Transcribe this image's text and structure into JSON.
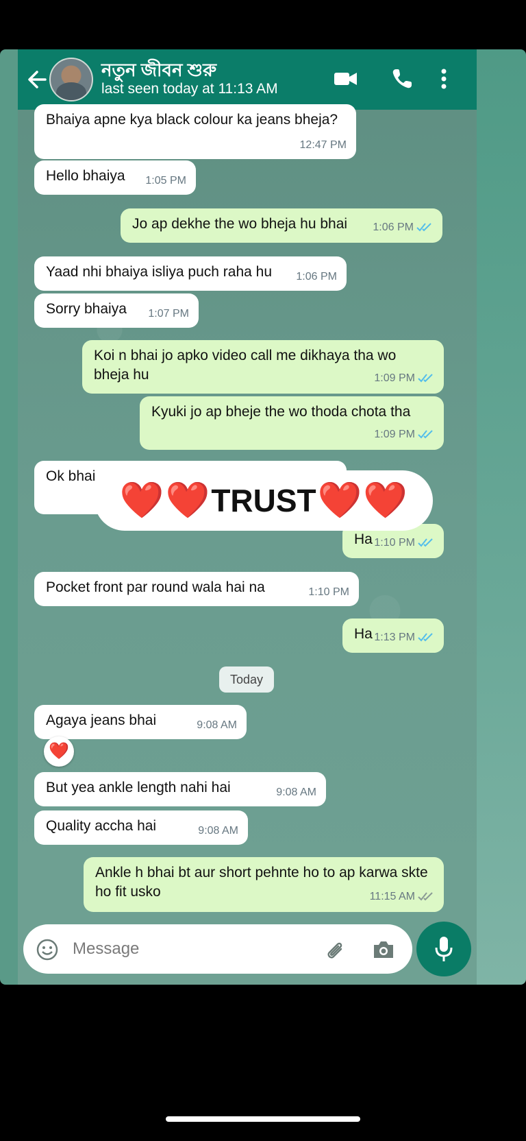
{
  "header": {
    "contact_name": "নতুন জীবন শুরু",
    "last_seen": "last seen today at 11:13 AM"
  },
  "messages": [
    {
      "text": "Bhaiya apne kya black colour ka jeans bheja?",
      "time": "12:47 PM",
      "dir": "in"
    },
    {
      "text": "Hello bhaiya",
      "time": "1:05 PM",
      "dir": "in"
    },
    {
      "text": "Jo ap dekhe the wo bheja hu bhai",
      "time": "1:06 PM",
      "dir": "out",
      "read": true
    },
    {
      "text": "Yaad nhi bhaiya isliya puch raha hu",
      "time": "1:06 PM",
      "dir": "in"
    },
    {
      "text": "Sorry bhaiya",
      "time": "1:07 PM",
      "dir": "in"
    },
    {
      "text": "Koi n bhai jo apko video call me dikhaya tha wo bheja hu",
      "time": "1:09 PM",
      "dir": "out",
      "read": true
    },
    {
      "text": "Kyuki jo ap bheje the wo thoda chota tha",
      "time": "1:09 PM",
      "dir": "out",
      "read": true
    },
    {
      "text": "Ok bhai",
      "time": "",
      "dir": "in"
    },
    {
      "text": "Ha",
      "time": "1:10 PM",
      "dir": "out",
      "read": true
    },
    {
      "text": "Pocket front par round wala hai na",
      "time": "1:10 PM",
      "dir": "in"
    },
    {
      "text": "Ha",
      "time": "1:13 PM",
      "dir": "out",
      "read": true
    },
    {
      "text": "Agaya jeans bhai",
      "time": "9:08 AM",
      "dir": "in"
    },
    {
      "text": "But yea ankle length nahi hai",
      "time": "9:08 AM",
      "dir": "in"
    },
    {
      "text": "Quality accha hai",
      "time": "9:08 AM",
      "dir": "in"
    },
    {
      "text": "Ankle h bhai bt aur short pehnte ho to ap karwa skte ho fit usko",
      "time": "11:15 AM",
      "dir": "out",
      "read": false
    }
  ],
  "date_divider": "Today",
  "overlay": {
    "text": "TRUST",
    "heart": "❤️"
  },
  "reaction": "❤️",
  "input": {
    "placeholder": "Message"
  },
  "colors": {
    "header": "#0b7d69",
    "outgoing_bubble": "#dcf8c6",
    "incoming_bubble": "#ffffff",
    "read_tick": "#53bdeb",
    "mic_button": "#0a7c66"
  },
  "icons": [
    "back-arrow-icon",
    "video-call-icon",
    "phone-icon",
    "more-vert-icon",
    "emoji-icon",
    "attach-icon",
    "camera-icon",
    "mic-icon",
    "double-tick-icon"
  ]
}
